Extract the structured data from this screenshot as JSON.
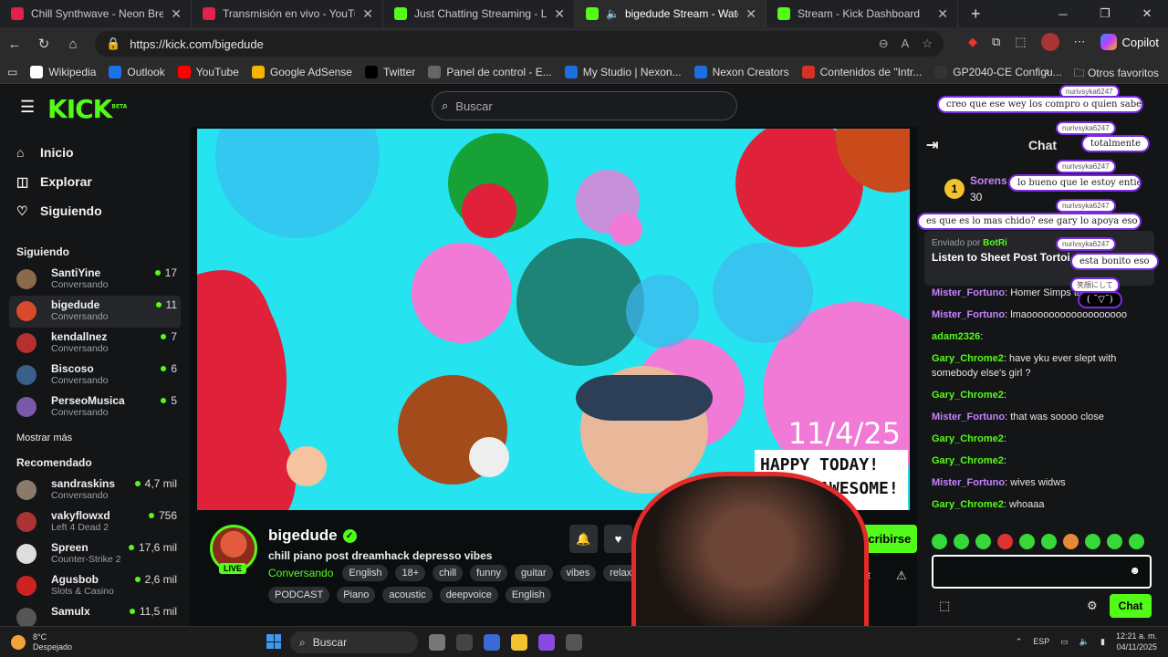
{
  "tabs": [
    {
      "title": "Chill Synthwave - Neon Breeze by",
      "color": "#e4204d"
    },
    {
      "title": "Transmisión en vivo - YouTube Stu",
      "color": "#e4204d"
    },
    {
      "title": "Just Chatting Streaming - Live Stre",
      "color": "#53fc18"
    },
    {
      "title": "bigedude Stream - Watch Liv",
      "color": "#53fc18"
    },
    {
      "title": "Stream - Kick Dashboard",
      "color": "#53fc18"
    }
  ],
  "browser": {
    "url": "https://kick.com/bigedude",
    "copilot": "Copilot"
  },
  "bookmarks": [
    {
      "label": "Wikipedia",
      "color": "#ffffff"
    },
    {
      "label": "Outlook",
      "color": "#1a73e8"
    },
    {
      "label": "YouTube",
      "color": "#ff0000"
    },
    {
      "label": "Google AdSense",
      "color": "#f4b400"
    },
    {
      "label": "Twitter",
      "color": "#000000"
    },
    {
      "label": "Panel de control - E...",
      "color": "#666666"
    },
    {
      "label": "My Studio | Nexon...",
      "color": "#1d6fe0"
    },
    {
      "label": "Nexon Creators",
      "color": "#1d6fe0"
    },
    {
      "label": "Contenidos de \"Intr...",
      "color": "#d93025"
    },
    {
      "label": "GP2040-CE Configu...",
      "color": "#333333"
    }
  ],
  "bookmarks_other": "Otros favoritos",
  "header": {
    "logo": "KICK",
    "beta": "BETA",
    "search_placeholder": "Buscar"
  },
  "nav": [
    {
      "label": "Inicio",
      "icon": "home-icon"
    },
    {
      "label": "Explorar",
      "icon": "compass-icon"
    },
    {
      "label": "Siguiendo",
      "icon": "heart-icon"
    }
  ],
  "following_title": "Siguiendo",
  "following": [
    {
      "name": "SantiYine",
      "sub": "Conversando",
      "viewers": "17",
      "color": "#8a6a4a"
    },
    {
      "name": "bigedude",
      "sub": "Conversando",
      "viewers": "11",
      "color": "#d84a2b"
    },
    {
      "name": "kendallnez",
      "sub": "Conversando",
      "viewers": "7",
      "color": "#b63030"
    },
    {
      "name": "Biscoso",
      "sub": "Conversando",
      "viewers": "6",
      "color": "#3a5f8a"
    },
    {
      "name": "PerseoMusica",
      "sub": "Conversando",
      "viewers": "5",
      "color": "#7a5aa8"
    }
  ],
  "show_more": "Mostrar más",
  "recommended_title": "Recomendado",
  "recommended": [
    {
      "name": "sandraskins",
      "sub": "Conversando",
      "viewers": "4,7 mil",
      "color": "#8a7a6a"
    },
    {
      "name": "vakyflowxd",
      "sub": "Left 4 Dead 2",
      "viewers": "756",
      "color": "#a33"
    },
    {
      "name": "Spreen",
      "sub": "Counter-Strike 2",
      "viewers": "17,6 mil",
      "color": "#ddd"
    },
    {
      "name": "Agusbob",
      "sub": "Slots & Casino",
      "viewers": "2,6 mil",
      "color": "#c22"
    },
    {
      "name": "Samulx",
      "sub": "",
      "viewers": "11,5 mil",
      "color": "#555"
    }
  ],
  "player": {
    "date_stamp": "11/4/25",
    "sign_line1": "HAPPY TODAY!",
    "sign_line2": "U ARE AWESOME!"
  },
  "streamer": {
    "name": "bigedude",
    "title": "chill piano post dreamhack depresso vibes",
    "category": "Conversando",
    "live": "LIVE",
    "subscribe": "Suscribirse"
  },
  "tags": [
    "English",
    "18+",
    "chill",
    "funny",
    "guitar",
    "vibes",
    "relax",
    "PODCAST",
    "Piano",
    "acoustic",
    "deepvoice",
    "English"
  ],
  "chat": {
    "title": "Chat",
    "top_user": "Sorens",
    "top_rank": "1",
    "top_count": "30",
    "pinned_by": "Enviado por",
    "pinned_bot": "BotRi",
    "pinned_msg": "Listen to Sheet Post Tortoi swearing)...",
    "messages": [
      {
        "user": "Mister_Fortuno",
        "cls": "p",
        "text": "Homer Simps tangent"
      },
      {
        "user": "Mister_Fortuno",
        "cls": "p",
        "text": "lmaoooooooooooooooooo"
      },
      {
        "user": "adam2326",
        "cls": "g",
        "text": ""
      },
      {
        "user": "Gary_Chrome2",
        "cls": "g",
        "text": "have yku ever slept with somebody else's girl ?"
      },
      {
        "user": "Gary_Chrome2",
        "cls": "g",
        "text": ""
      },
      {
        "user": "Mister_Fortuno",
        "cls": "p",
        "text": "that was soooo close"
      },
      {
        "user": "Gary_Chrome2",
        "cls": "g",
        "text": ""
      },
      {
        "user": "Gary_Chrome2",
        "cls": "g",
        "text": ""
      },
      {
        "user": "Mister_Fortuno",
        "cls": "p",
        "text": "wives widws"
      },
      {
        "user": "Gary_Chrome2",
        "cls": "g",
        "text": "whoaaa"
      }
    ],
    "send": "Chat"
  },
  "overlay": [
    {
      "text": "creo que ese wey los compro o quien sabe el gary",
      "name": "nurivsyka6247"
    },
    {
      "text": "totalmente",
      "name": "nurivsyka6247"
    },
    {
      "text": "lo bueno que le estoy entiendo",
      "name": "nurivsyka6247"
    },
    {
      "text": "es que es lo mas chido? ese gary lo apoya eso esta chido",
      "name": "nurivsyka6247"
    },
    {
      "text": "esta bonito eso",
      "name": "nurivsyka6247"
    },
    {
      "text": "( ˘▽˘)",
      "name": "笑顔にして"
    }
  ],
  "taskbar": {
    "temp": "8°C",
    "weather": "Despejado",
    "search": "Buscar",
    "lang": "ESP",
    "time": "12:21 a. m.",
    "date": "04/11/2025"
  }
}
